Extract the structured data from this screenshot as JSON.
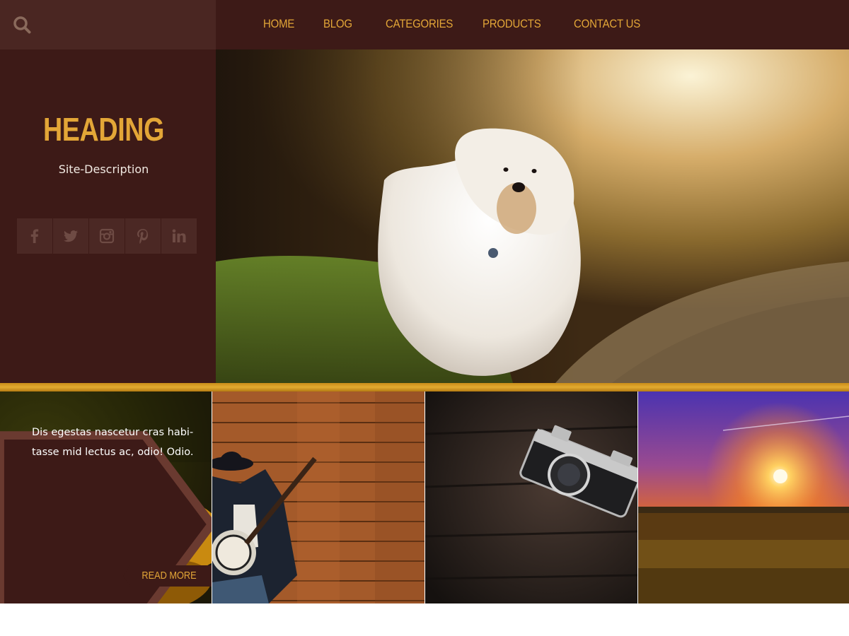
{
  "search": {
    "icon": "search-icon"
  },
  "nav": {
    "items": [
      {
        "label": "HOME"
      },
      {
        "label": "BLOG"
      },
      {
        "label": "CATEGORIES"
      },
      {
        "label": "PRODUCTS"
      },
      {
        "label": "CONTACT US"
      }
    ]
  },
  "sidebar": {
    "heading": "HEADING",
    "description": "Site-Description",
    "social": [
      {
        "icon": "facebook-icon"
      },
      {
        "icon": "twitter-icon"
      },
      {
        "icon": "instagram-icon"
      },
      {
        "icon": "pinterest-icon"
      },
      {
        "icon": "linkedin-icon"
      }
    ]
  },
  "hero": {
    "image": "white-dog-on-forest-path"
  },
  "gallery": {
    "featured": {
      "text": "Dis egestas nascetur cras habi-tasse mid lectus ac, odio! Odio.",
      "button_label": "READ MORE",
      "image": "yellow-flower"
    },
    "tiles": [
      {
        "image": "banjo-player-on-wood-wall"
      },
      {
        "image": "vintage-camera-on-wood"
      },
      {
        "image": "sunset-over-field"
      }
    ]
  },
  "colors": {
    "accent": "#e3a637",
    "dark_brown": "#3d1a17",
    "gold_bar": "#d49d26"
  }
}
